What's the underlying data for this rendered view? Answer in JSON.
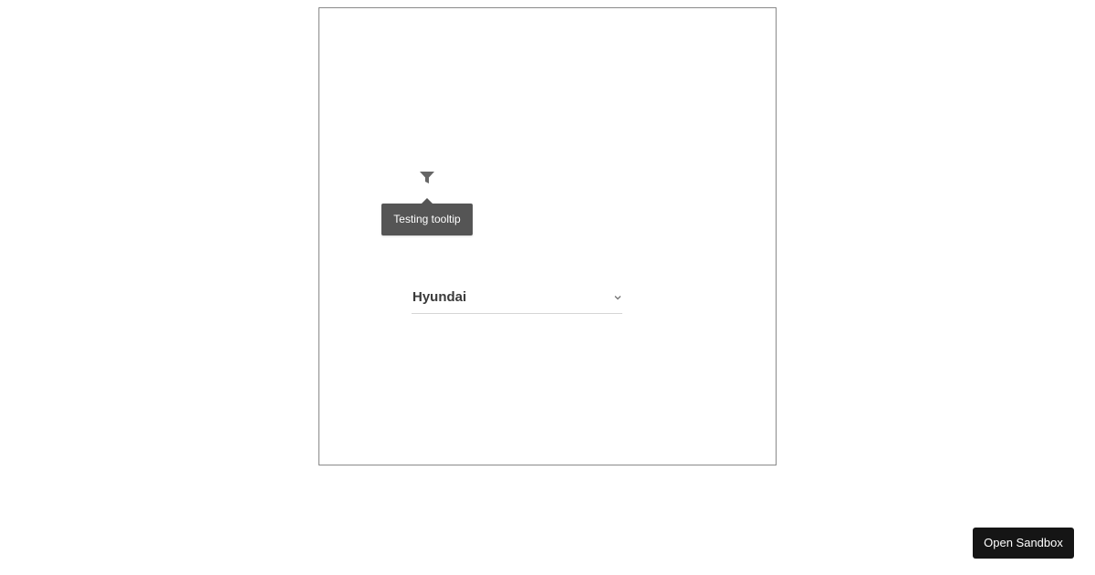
{
  "tooltip": {
    "text": "Testing tooltip"
  },
  "filter": {
    "icon": "filter-icon"
  },
  "dropdown": {
    "selected_value": "Hyundai",
    "icon": "chevron-down-icon"
  },
  "sandbox": {
    "button_label": "Open Sandbox"
  },
  "colors": {
    "tooltip_bg": "#555555",
    "button_bg": "#151515",
    "frame_border": "#8a8a8a",
    "icon_color": "#666666"
  }
}
